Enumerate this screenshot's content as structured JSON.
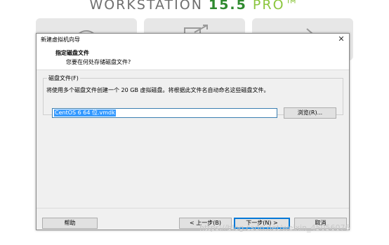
{
  "banner": {
    "product": "WORKSTATION",
    "version": "15.5",
    "edition": "PRO",
    "trademark": "™"
  },
  "dialog": {
    "title": "新建虚拟机向导",
    "close_glyph": "✕",
    "header_title": "指定磁盘文件",
    "header_subtitle": "您要在何处存储磁盘文件?",
    "group_label": "磁盘文件(F)",
    "description": "将使用多个磁盘文件创建一个 20 GB 虚拟磁盘。将根据此文件名自动命名这些磁盘文件。",
    "file_value": "CentOS 6 64 位.vmdk",
    "browse_label": "浏览(R)...",
    "help_label": "帮助",
    "back_label": "< 上一步(B)",
    "next_label": "下一步(N) >",
    "cancel_label": "取消"
  },
  "watermark": "https://blog.csdn.net/weixin_45056076",
  "colors": {
    "accent": "#0078d7",
    "selection": "#3399ff",
    "version_green": "#2f8a2f",
    "edition_green": "#8cc63f"
  },
  "icons": [
    "close-icon",
    "create-vm-icon",
    "open-vm-icon",
    "connect-server-icon"
  ]
}
